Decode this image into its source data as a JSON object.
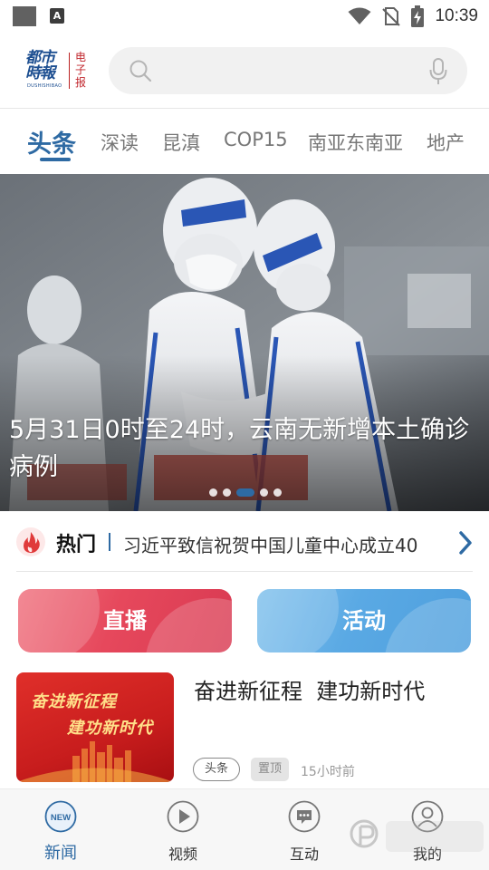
{
  "status_bar": {
    "time": "10:39",
    "app_badge": "A"
  },
  "header": {
    "logo": {
      "name_line1": "都市",
      "name_line2": "時報",
      "roman": "DUSHISHIBAO",
      "side_text": "电子报"
    },
    "search": {
      "placeholder": ""
    }
  },
  "tabs": [
    {
      "label": "头条",
      "active": true
    },
    {
      "label": "深读",
      "active": false
    },
    {
      "label": "昆滇",
      "active": false
    },
    {
      "label": "COP15",
      "active": false
    },
    {
      "label": "南亚东南亚",
      "active": false
    },
    {
      "label": "地产",
      "active": false
    }
  ],
  "hero": {
    "title": "5月31日0时至24时，云南无新增本土确诊病例",
    "slide_count": 5,
    "active_slide": 3
  },
  "hot": {
    "label": "热门",
    "headline": "习近平致信祝贺中国儿童中心成立40"
  },
  "actions": {
    "live_label": "直播",
    "activity_label": "活动"
  },
  "news": [
    {
      "title": "奋进新征程  建功新时代",
      "thumb_line1": "奋进新征程",
      "thumb_line2": "建功新时代",
      "tag": "头条",
      "pin": "置顶",
      "time": "15小时前"
    }
  ],
  "bottom_nav": [
    {
      "label": "新闻",
      "icon": "news-icon",
      "icon_text": "NEW",
      "active": true
    },
    {
      "label": "视频",
      "icon": "play-icon",
      "active": false
    },
    {
      "label": "互动",
      "icon": "chat-icon",
      "active": false
    },
    {
      "label": "我的",
      "icon": "user-icon",
      "active": false
    }
  ],
  "colors": {
    "brand_blue": "#2e6aa3",
    "live_red": "#e6485c",
    "activity_blue": "#5aa9e4",
    "hot_red": "#e03a3a"
  }
}
